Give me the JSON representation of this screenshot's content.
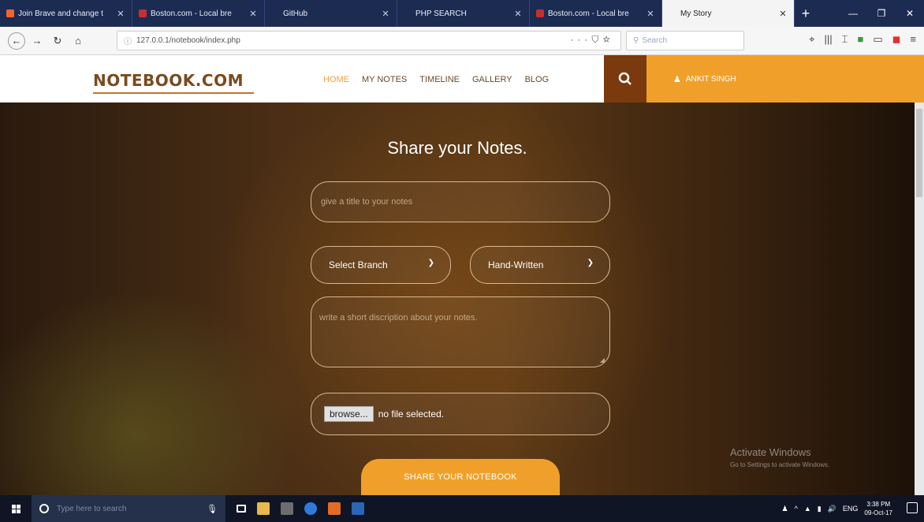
{
  "browser": {
    "tabs": [
      {
        "title": "Join Brave and change t",
        "fav": "#f2652a",
        "active": false
      },
      {
        "title": "Boston.com - Local bre",
        "fav": "#c43030",
        "active": false
      },
      {
        "title": "GitHub",
        "fav": "",
        "active": false
      },
      {
        "title": "PHP SEARCH",
        "fav": "",
        "active": false
      },
      {
        "title": "Boston.com - Local bre",
        "fav": "#c43030",
        "active": false
      },
      {
        "title": "My Story",
        "fav": "",
        "active": true
      }
    ],
    "url": "127.0.0.1/notebook/index.php",
    "search_placeholder": "Search"
  },
  "site": {
    "brand": "NOTEBOOK.COM",
    "menu": [
      "HOME",
      "MY NOTES",
      "TIMELINE",
      "GALLERY",
      "BLOG"
    ],
    "user_name": "ANKIT SINGH"
  },
  "form": {
    "heading": "Share your Notes.",
    "title_placeholder": "give a title to your notes",
    "branch_select": "Select Branch",
    "type_select": "Hand-Written",
    "description_placeholder": "write a short discription about your notes.",
    "browse_label": "browse...",
    "file_status": "no file selected.",
    "submit_label": "SHARE YOUR NOTEBOOK"
  },
  "watermark": {
    "line1": "Activate Windows",
    "line2": "Go to Settings to activate Windows."
  },
  "taskbar": {
    "search_placeholder": "Type here to search",
    "lang": "ENG",
    "time": "3:38 PM",
    "date": "09-Oct-17"
  }
}
